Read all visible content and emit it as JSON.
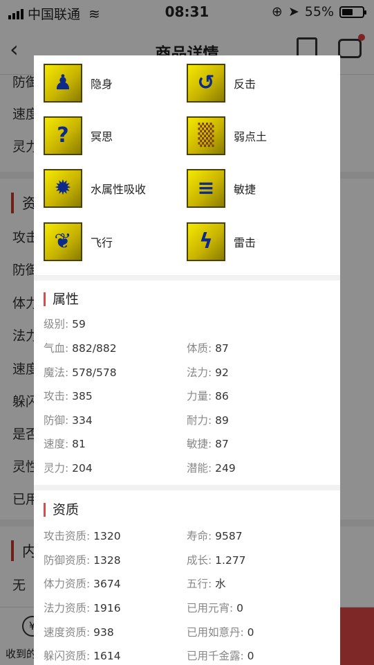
{
  "status_bar": {
    "carrier": "中国联通",
    "time": "08:31",
    "battery": "55%",
    "battery_level": 0.55
  },
  "nav": {
    "title": "商品详情"
  },
  "background": {
    "lines_top": [
      "防御",
      "速度",
      "灵力"
    ],
    "section1": "资质",
    "lines_mid": [
      "攻击",
      "防御",
      "体力",
      "法力",
      "速度",
      "躲闪",
      "是否",
      "灵性",
      "已用"
    ],
    "section2": "内",
    "line_last": "无",
    "bottom_label": "收到的",
    "coin_glyph": "¥"
  },
  "skills": [
    {
      "name": "隐身",
      "icon": "figure-icon"
    },
    {
      "name": "反击",
      "icon": "counter-arrow-icon"
    },
    {
      "name": "冥思",
      "icon": "meditation-icon"
    },
    {
      "name": "弱点土",
      "icon": "earth-weakness-icon"
    },
    {
      "name": "水属性吸收",
      "icon": "water-absorb-icon"
    },
    {
      "name": "敏捷",
      "icon": "agility-icon"
    },
    {
      "name": "飞行",
      "icon": "wing-icon"
    },
    {
      "name": "雷击",
      "icon": "lightning-icon"
    }
  ],
  "attributes": {
    "title": "属性",
    "level": {
      "k": "级别:",
      "v": "59"
    },
    "rows": [
      [
        {
          "k": "气血:",
          "v": "882/882"
        },
        {
          "k": "体质:",
          "v": "87"
        }
      ],
      [
        {
          "k": "魔法:",
          "v": "578/578"
        },
        {
          "k": "法力:",
          "v": "92"
        }
      ],
      [
        {
          "k": "攻击:",
          "v": "385"
        },
        {
          "k": "力量:",
          "v": "86"
        }
      ],
      [
        {
          "k": "防御:",
          "v": "334"
        },
        {
          "k": "耐力:",
          "v": "89"
        }
      ],
      [
        {
          "k": "速度:",
          "v": "81"
        },
        {
          "k": "敏捷:",
          "v": "87"
        }
      ],
      [
        {
          "k": "灵力:",
          "v": "204"
        },
        {
          "k": "潜能:",
          "v": "249"
        }
      ]
    ]
  },
  "aptitude": {
    "title": "资质",
    "rows": [
      [
        {
          "k": "攻击资质:",
          "v": "1320"
        },
        {
          "k": "寿命:",
          "v": "9587"
        }
      ],
      [
        {
          "k": "防御资质:",
          "v": "1328"
        },
        {
          "k": "成长:",
          "v": "1.277"
        }
      ],
      [
        {
          "k": "体力资质:",
          "v": "3674"
        },
        {
          "k": "五行:",
          "v": "水"
        }
      ],
      [
        {
          "k": "法力资质:",
          "v": "1916"
        },
        {
          "k": "已用元宵:",
          "v": "0"
        }
      ],
      [
        {
          "k": "速度资质:",
          "v": "938"
        },
        {
          "k": "已用如意丹:",
          "v": "0"
        }
      ],
      [
        {
          "k": "躲闪资质:",
          "v": "1614"
        },
        {
          "k": "已用千金露:",
          "v": "0"
        }
      ]
    ]
  },
  "colors": {
    "accent": "#d94a4a",
    "icon_bg": "#e8d800",
    "icon_fg": "#0d2a8a"
  }
}
